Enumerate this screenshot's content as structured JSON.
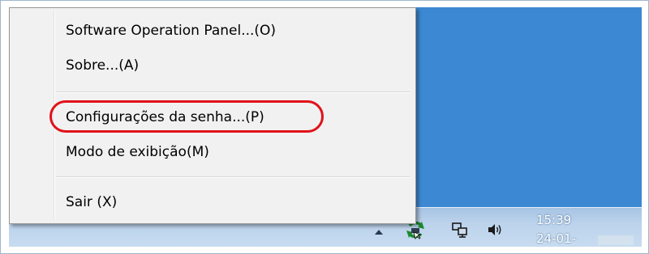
{
  "context_menu": {
    "items": [
      {
        "label": "Software Operation Panel...(O)"
      },
      {
        "label": "Sobre...(A)"
      },
      {
        "label": "Configurações da senha...(P)",
        "highlighted": true
      },
      {
        "label": "Modo de exibição(M)"
      },
      {
        "label": "Sair (X)"
      }
    ],
    "highlight_color": "#e0121b"
  },
  "taskbar": {
    "tray_icons": [
      "show-hidden-icons-arrow",
      "scanner-icon",
      "network-icon",
      "volume-icon"
    ],
    "clock": {
      "time": "15:39",
      "date": "24-01-"
    }
  },
  "colors": {
    "desktop": "#3d88d2",
    "taskbar": "#bcd3ec",
    "menu_bg": "#f1f1f1"
  }
}
